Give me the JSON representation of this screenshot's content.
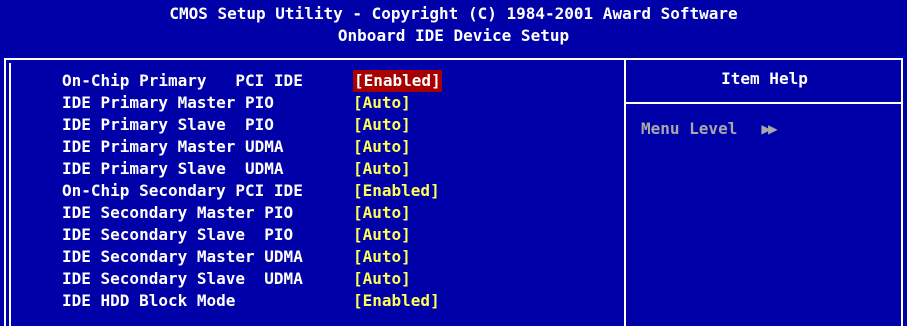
{
  "header": {
    "line1": "CMOS Setup Utility - Copyright (C) 1984-2001 Award Software",
    "line2": "Onboard IDE Device Setup"
  },
  "help": {
    "title": "Item Help",
    "menu_level_label": "Menu Level",
    "menu_level_arrows": "▶▶"
  },
  "settings": [
    {
      "label": "On-Chip Primary   PCI IDE",
      "value": "[Enabled]",
      "selected": true
    },
    {
      "label": "IDE Primary Master PIO",
      "value": "[Auto]"
    },
    {
      "label": "IDE Primary Slave  PIO",
      "value": "[Auto]"
    },
    {
      "label": "IDE Primary Master UDMA",
      "value": "[Auto]"
    },
    {
      "label": "IDE Primary Slave  UDMA",
      "value": "[Auto]"
    },
    {
      "label": "On-Chip Secondary PCI IDE",
      "value": "[Enabled]"
    },
    {
      "label": "IDE Secondary Master PIO",
      "value": "[Auto]"
    },
    {
      "label": "IDE Secondary Slave  PIO",
      "value": "[Auto]"
    },
    {
      "label": "IDE Secondary Master UDMA",
      "value": "[Auto]"
    },
    {
      "label": "IDE Secondary Slave  UDMA",
      "value": "[Auto]"
    },
    {
      "label": "IDE HDD Block Mode",
      "value": "[Enabled]"
    }
  ],
  "colors": {
    "background": "#0000a8",
    "value_text": "#ffff54",
    "selected_bg": "#a80000",
    "help_text": "#a8a8a8"
  }
}
